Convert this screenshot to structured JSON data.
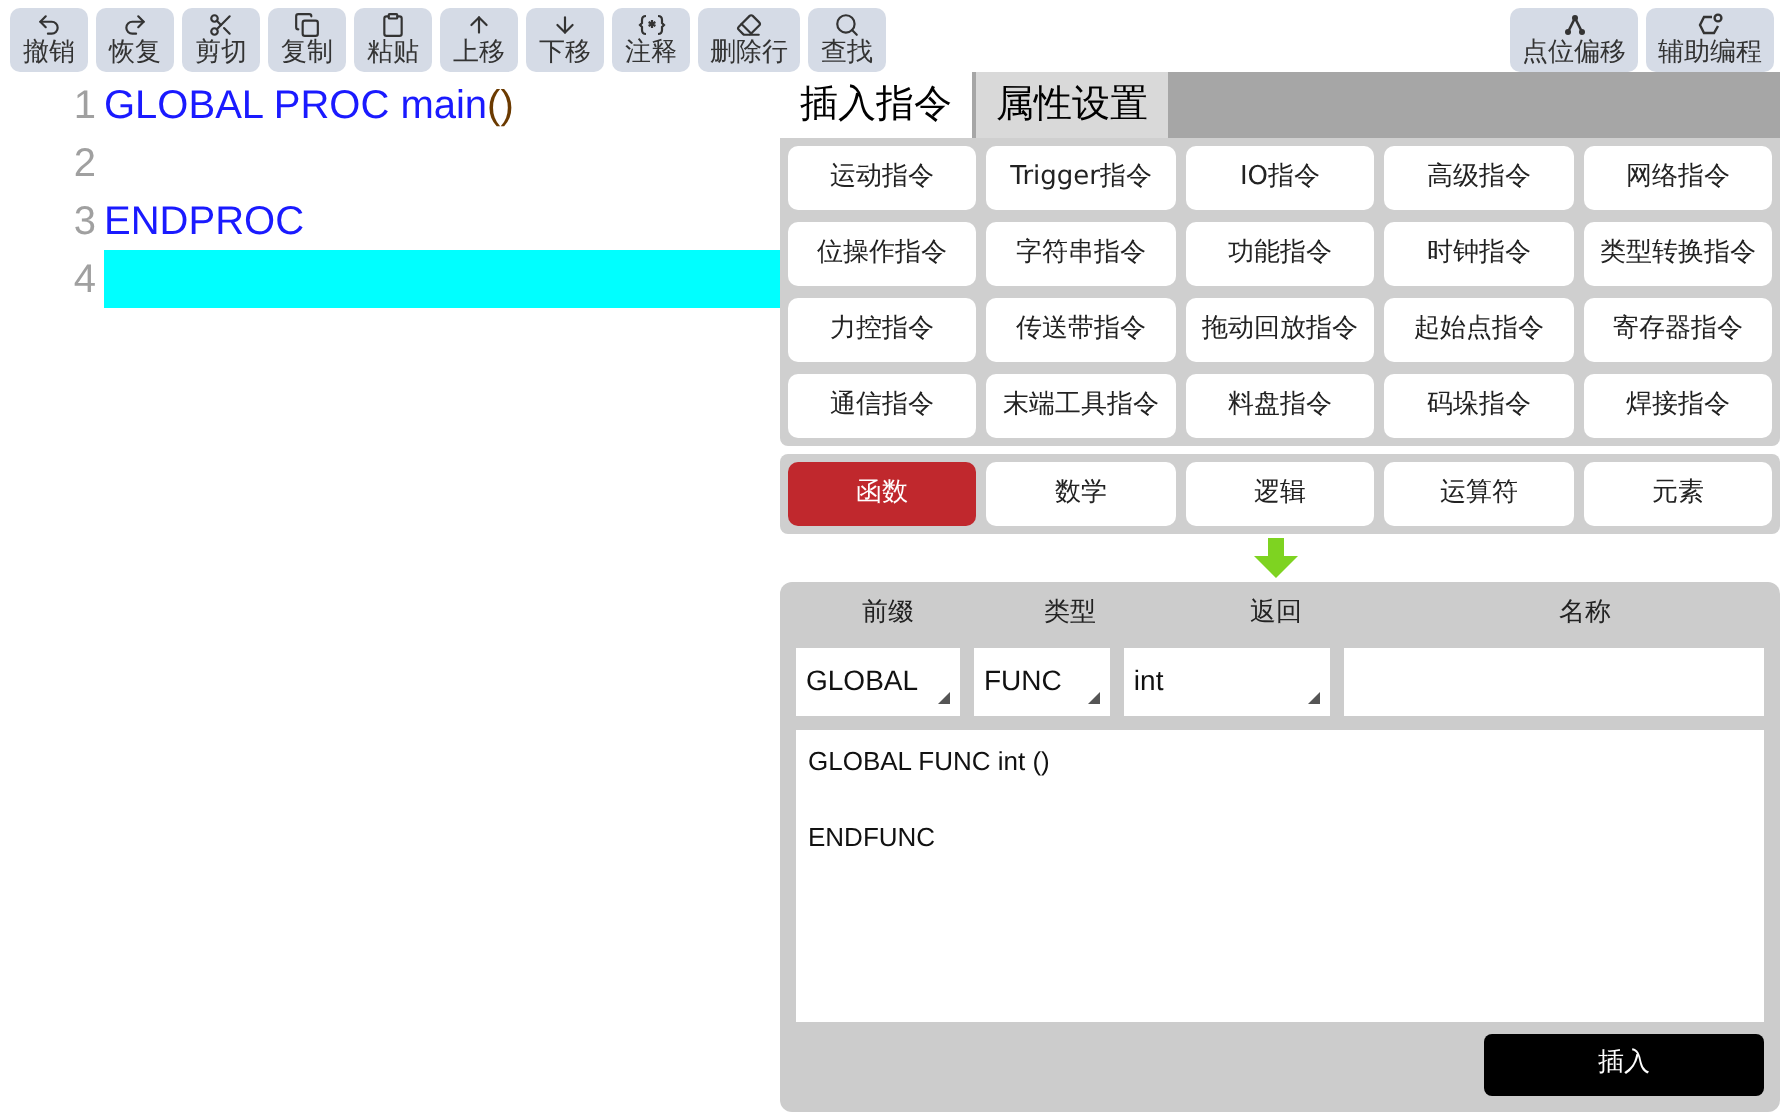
{
  "toolbar": [
    {
      "label": "撤销"
    },
    {
      "label": "恢复"
    },
    {
      "label": "剪切"
    },
    {
      "label": "复制"
    },
    {
      "label": "粘贴"
    },
    {
      "label": "上移"
    },
    {
      "label": "下移"
    },
    {
      "label": "注释"
    },
    {
      "label": "删除行"
    },
    {
      "label": "查找"
    }
  ],
  "toolbar_right": [
    {
      "label": "点位偏移"
    },
    {
      "label": "辅助编程"
    }
  ],
  "editor": {
    "lines": [
      {
        "number": "1",
        "selected": false,
        "tokens": [
          {
            "text": "GLOBAL PROC main",
            "kind": "keyword"
          },
          {
            "text": "()",
            "kind": "paren"
          }
        ]
      },
      {
        "number": "2",
        "selected": false
      },
      {
        "number": "3",
        "selected": false,
        "tokens": [
          {
            "text": "ENDPROC",
            "kind": "keyword"
          }
        ]
      },
      {
        "number": "4",
        "selected": true
      }
    ]
  },
  "tabs": [
    {
      "label": "插入指令",
      "selected": true
    },
    {
      "label": "属性设置",
      "selected": false
    }
  ],
  "instructions": [
    "运动指令",
    "Trigger指令",
    "IO指令",
    "高级指令",
    "网络指令",
    "位操作指令",
    "字符串指令",
    "功能指令",
    "时钟指令",
    "类型转换指令",
    "力控指令",
    "传送带指令",
    "拖动回放指令",
    "起始点指令",
    "寄存器指令",
    "通信指令",
    "末端工具指令",
    "料盘指令",
    "码垛指令",
    "焊接指令"
  ],
  "categories": [
    {
      "label": "函数",
      "selected": true
    },
    {
      "label": "数学",
      "selected": false
    },
    {
      "label": "逻辑",
      "selected": false
    },
    {
      "label": "运算符",
      "selected": false
    },
    {
      "label": "元素",
      "selected": false
    }
  ],
  "form": {
    "prefix": {
      "label": "前缀",
      "value": "GLOBAL"
    },
    "type": {
      "label": "类型",
      "value": "FUNC"
    },
    "return": {
      "label": "返回",
      "value": "int"
    },
    "name": {
      "label": "名称"
    },
    "preview": "GLOBAL FUNC int ()\n\nENDFUNC",
    "insert_button": "插入"
  }
}
